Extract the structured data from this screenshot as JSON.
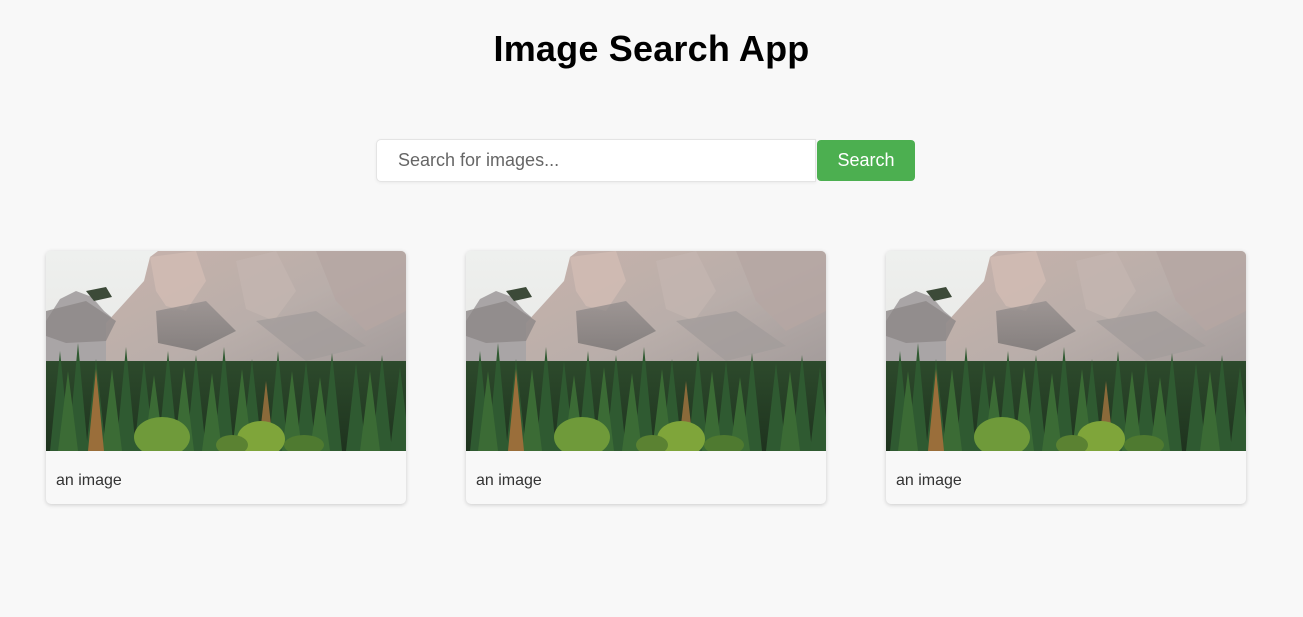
{
  "app": {
    "title": "Image Search App"
  },
  "search": {
    "placeholder": "Search for images...",
    "value": "",
    "button_label": "Search"
  },
  "results": [
    {
      "caption": "an image",
      "image": "mountain-forest-photo"
    },
    {
      "caption": "an image",
      "image": "mountain-forest-photo"
    },
    {
      "caption": "an image",
      "image": "mountain-forest-photo"
    }
  ],
  "colors": {
    "background": "#f8f8f8",
    "accent": "#4caf50"
  }
}
